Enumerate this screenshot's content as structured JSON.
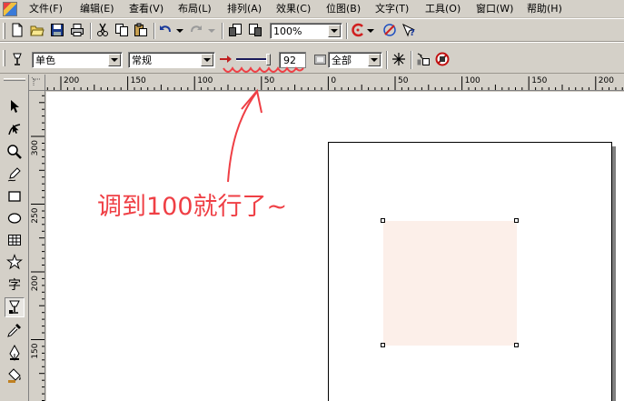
{
  "menu": {
    "items": [
      "文件(F)",
      "编辑(E)",
      "查看(V)",
      "布局(L)",
      "排列(A)",
      "效果(C)",
      "位图(B)",
      "文字(T)",
      "工具(O)",
      "窗口(W)",
      "帮助(H)"
    ]
  },
  "standard_toolbar": {
    "zoom_value": "100%"
  },
  "property_bar": {
    "outline_color_mode": "单色",
    "blend_mode": "常规",
    "transparency_value": "92",
    "apply_target": "全部"
  },
  "rulers": {
    "horizontal_labels": [
      "200",
      "150",
      "100",
      "50",
      "0",
      "50",
      "100",
      "150",
      "200"
    ],
    "vertical_labels": [
      "300",
      "250",
      "200",
      "150"
    ]
  },
  "annotation": {
    "text": "调到100就行了~",
    "color": "#ef3f45"
  },
  "colors": {
    "chrome": "#d4d0c8",
    "object_fill": "#fcefe9",
    "canvas": "#ffffff"
  }
}
